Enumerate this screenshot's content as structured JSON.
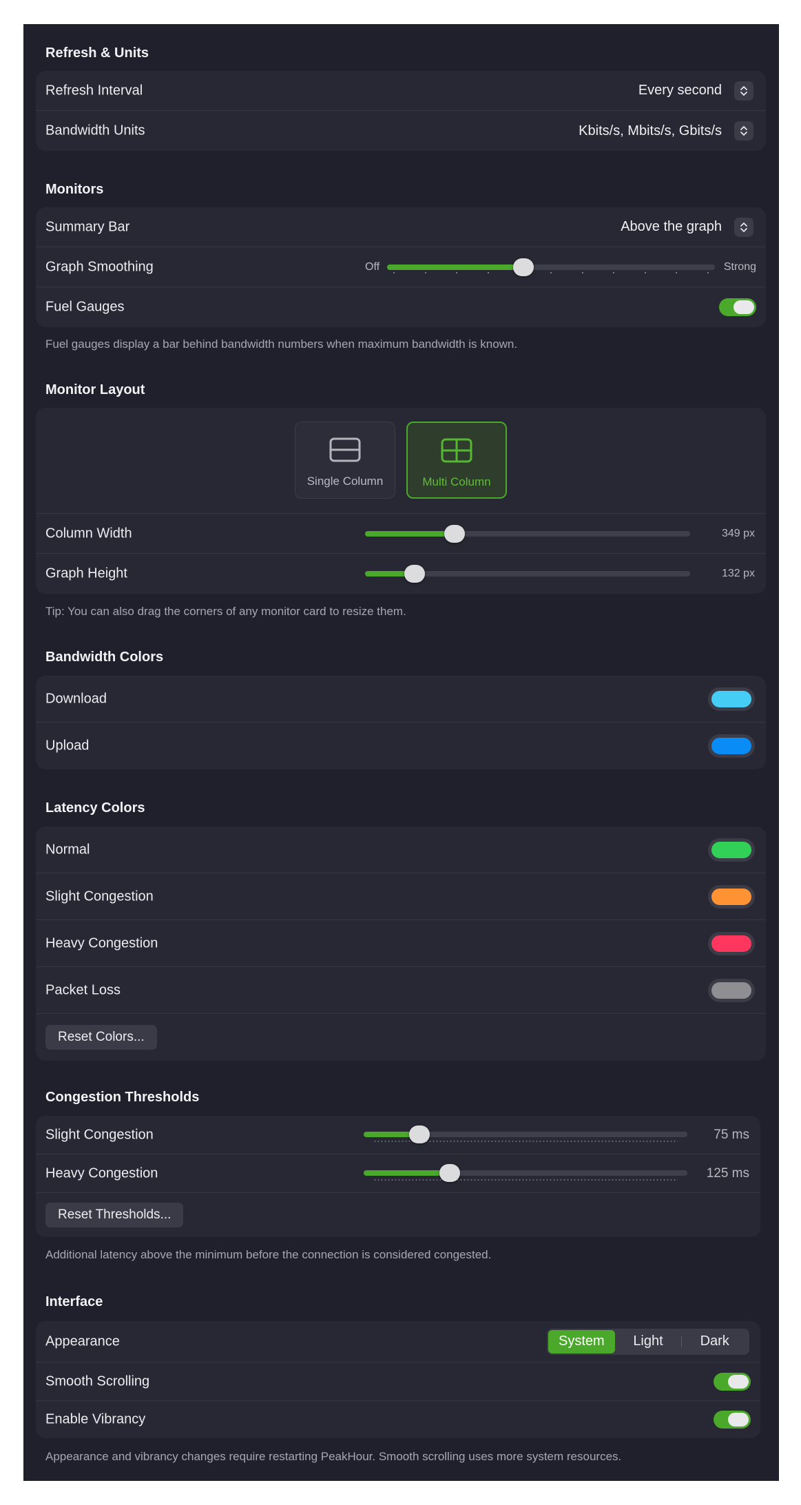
{
  "refresh_units": {
    "title": "Refresh & Units",
    "refresh_interval": {
      "label": "Refresh Interval",
      "value": "Every second"
    },
    "bandwidth_units": {
      "label": "Bandwidth Units",
      "value": "Kbits/s, Mbits/s, Gbits/s"
    }
  },
  "monitors": {
    "title": "Monitors",
    "summary_bar": {
      "label": "Summary Bar",
      "value": "Above the graph"
    },
    "graph_smoothing": {
      "label": "Graph Smoothing",
      "min_label": "Off",
      "max_label": "Strong",
      "value": 0.41
    },
    "fuel_gauges": {
      "label": "Fuel Gauges",
      "on": true
    },
    "note": "Fuel gauges display a bar behind bandwidth numbers when maximum bandwidth is known."
  },
  "monitor_layout": {
    "title": "Monitor Layout",
    "options": [
      {
        "label": "Single Column",
        "icon": "single-column-icon",
        "selected": false
      },
      {
        "label": "Multi Column",
        "icon": "multi-column-icon",
        "selected": true
      }
    ],
    "column_width": {
      "label": "Column Width",
      "value_text": "349 px",
      "value": 0.26
    },
    "graph_height": {
      "label": "Graph Height",
      "value_text": "132 px",
      "value": 0.13
    },
    "note": "Tip: You can also drag the corners of any monitor card to resize them."
  },
  "bandwidth_colors": {
    "title": "Bandwidth Colors",
    "items": [
      {
        "label": "Download",
        "color": "#46cdf5"
      },
      {
        "label": "Upload",
        "color": "#0a8cf7"
      }
    ]
  },
  "latency_colors": {
    "title": "Latency Colors",
    "items": [
      {
        "label": "Normal",
        "color": "#31d158"
      },
      {
        "label": "Slight Congestion",
        "color": "#ff9232"
      },
      {
        "label": "Heavy Congestion",
        "color": "#ff375f"
      },
      {
        "label": "Packet Loss",
        "color": "#8e8e93"
      }
    ],
    "reset_label": "Reset Colors..."
  },
  "congestion_thresholds": {
    "title": "Congestion Thresholds",
    "slight": {
      "label": "Slight Congestion",
      "value_text": "75 ms",
      "value": 0.15
    },
    "heavy": {
      "label": "Heavy Congestion",
      "value_text": "125 ms",
      "value": 0.25
    },
    "reset_label": "Reset Thresholds...",
    "note": "Additional latency above the minimum before the connection is considered congested."
  },
  "interface": {
    "title": "Interface",
    "appearance": {
      "label": "Appearance",
      "options": [
        "System",
        "Light",
        "Dark"
      ],
      "selected": 0
    },
    "smooth_scrolling": {
      "label": "Smooth Scrolling",
      "on": true
    },
    "enable_vibrancy": {
      "label": "Enable Vibrancy",
      "on": true
    },
    "note": "Appearance and vibrancy changes require restarting PeakHour. Smooth scrolling uses more system resources."
  },
  "colors": {
    "accent": "#4aa82a",
    "background": "#1f202b",
    "group": "#272833"
  }
}
